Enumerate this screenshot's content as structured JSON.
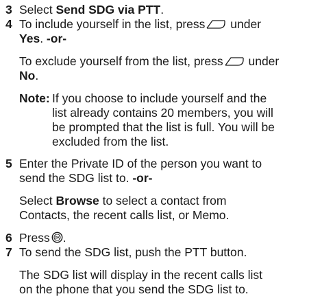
{
  "steps": {
    "s3": {
      "num": "3",
      "pre": "Select ",
      "bold": "Send SDG via PTT",
      "post": "."
    },
    "s4": {
      "num": "4",
      "line1_pre": "To include yourself in the list, press",
      "line1_post": " under",
      "line2_bold1": "Yes",
      "line2_mid": ". ",
      "line2_bold2": "-or-",
      "alt1_pre": "To exclude yourself from the list, press",
      "alt1_post": " under",
      "alt2_bold": "No",
      "alt2_post": ".",
      "note": {
        "label": "Note:",
        "lines": [
          "If you choose to include yourself and the",
          "list already contains 20 members, you will",
          "be prompted that the list is full. You will be",
          "excluded from the list."
        ]
      }
    },
    "s5": {
      "num": "5",
      "line1": "Enter the Private ID of the person you want to",
      "line2_pre": "send the SDG list to. ",
      "line2_bold": "-or-",
      "alt1_pre": "Select ",
      "alt1_bold": "Browse",
      "alt1_post": " to select a contact from",
      "alt2": "Contacts, the recent calls list, or Memo."
    },
    "s6": {
      "num": "6",
      "pre": "Press",
      "post": "."
    },
    "s7": {
      "num": "7",
      "line1": "To send the SDG list, push the PTT button.",
      "para1": "The SDG list will display in the recent calls list",
      "para2": "on the phone that you send the SDG list to."
    }
  },
  "icons": {
    "softkey": "softkey-icon",
    "ok": "ok-button-icon"
  }
}
